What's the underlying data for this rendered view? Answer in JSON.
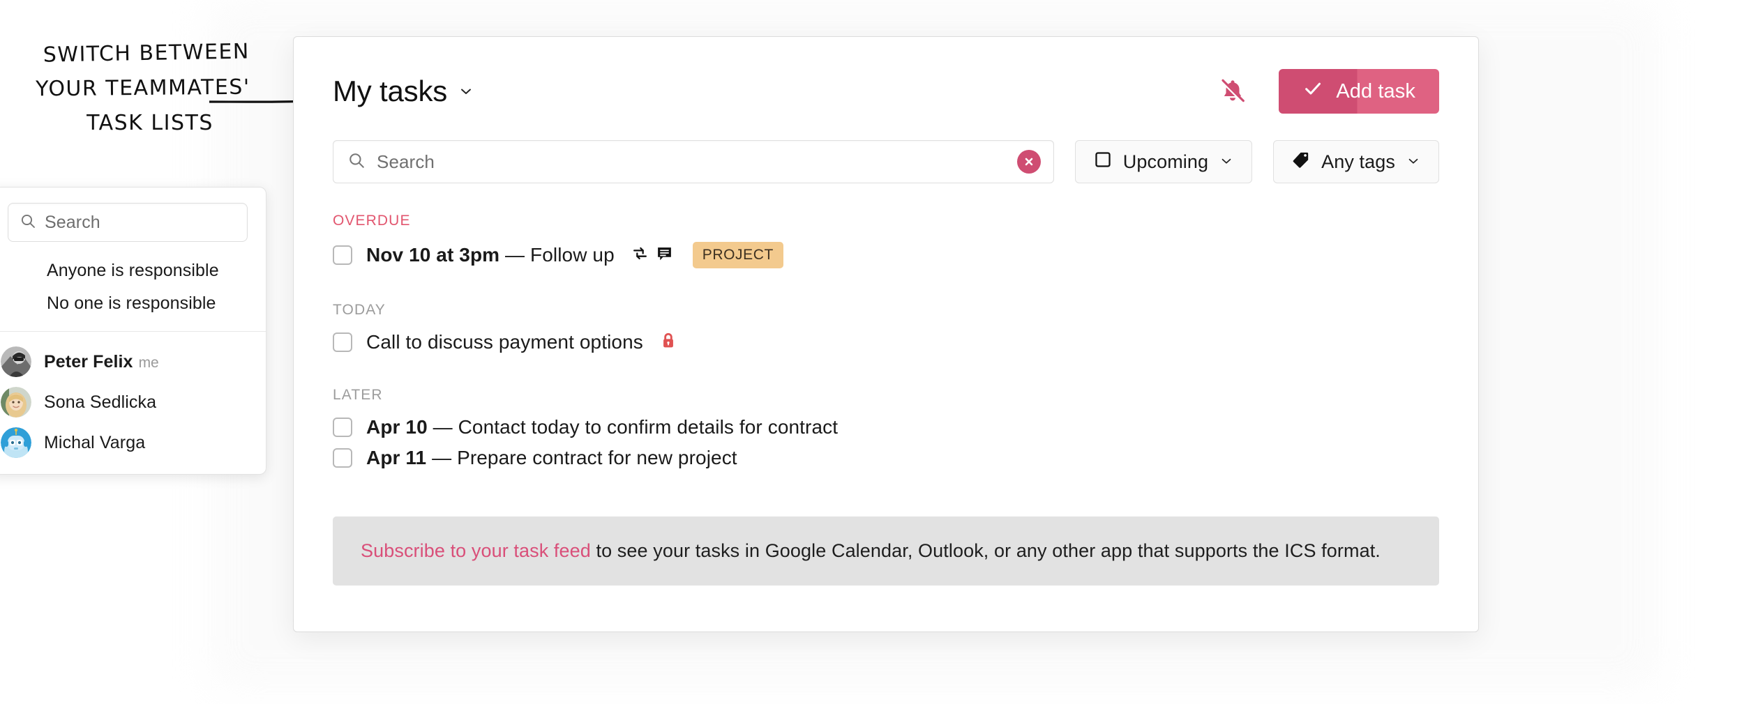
{
  "annotation": {
    "line1": "SWITCH BETWEEN",
    "line2": "YOUR TEAMMATES'",
    "line3": "TASK LISTS",
    "arrow_icon": "arrow-right-icon"
  },
  "people_panel": {
    "search": {
      "placeholder": "Search",
      "value": "",
      "icon": "search-icon"
    },
    "options": [
      {
        "label": "Anyone is responsible"
      },
      {
        "label": "No one is responsible"
      }
    ],
    "people": [
      {
        "name": "Peter Felix",
        "suffix": "me",
        "avatar": "avatar-photo-grayscale",
        "is_me": true
      },
      {
        "name": "Sona Sedlicka",
        "suffix": "",
        "avatar": "avatar-photo-blonde",
        "is_me": false
      },
      {
        "name": "Michal Varga",
        "suffix": "",
        "avatar": "avatar-robot-blue",
        "is_me": false
      }
    ]
  },
  "header": {
    "title": "My tasks",
    "chevron_icon": "chevron-down-icon",
    "bell_icon": "bell-off-icon",
    "add_task_label": "Add task",
    "add_task_icon": "check-icon"
  },
  "filters": {
    "search": {
      "placeholder": "Search",
      "value": "",
      "icon": "search-icon",
      "clear_icon": "clear-circle-icon"
    },
    "date_filter": {
      "label": "Upcoming",
      "icon": "calendar-square-icon",
      "chevron_icon": "chevron-down-icon"
    },
    "tag_filter": {
      "label": "Any tags",
      "icon": "tag-icon",
      "chevron_icon": "chevron-down-icon"
    }
  },
  "groups": [
    {
      "label": "OVERDUE",
      "style": "overdue",
      "tasks": [
        {
          "date": "Nov 10 at 3pm",
          "dash": " — ",
          "text": "Follow up",
          "icons": [
            "repeat-icon",
            "note-icon"
          ],
          "tag": "PROJECT",
          "lock": false
        }
      ]
    },
    {
      "label": "TODAY",
      "style": "normal",
      "tasks": [
        {
          "date": "",
          "dash": "",
          "text": "Call to discuss payment options",
          "icons": [],
          "tag": "",
          "lock": true
        }
      ]
    },
    {
      "label": "LATER",
      "style": "normal",
      "tasks": [
        {
          "date": "Apr 10",
          "dash": " — ",
          "text": "Contact today to confirm details for contract",
          "icons": [],
          "tag": "",
          "lock": false
        },
        {
          "date": "Apr 11",
          "dash": " — ",
          "text": "Prepare contract for new project",
          "icons": [],
          "tag": "",
          "lock": false
        }
      ]
    }
  ],
  "banner": {
    "link_text": "Subscribe to your task feed",
    "rest_text": " to see your tasks in Google Calendar, Outlook, or any other app that supports the ICS format."
  },
  "colors": {
    "accent_pink": "#cf4d72",
    "accent_pink_light": "#df6282",
    "overdue_red": "#e2566f",
    "tag_orange": "#f3ca8e",
    "lock_red": "#e05252",
    "banner_bg": "#e2e2e2"
  }
}
